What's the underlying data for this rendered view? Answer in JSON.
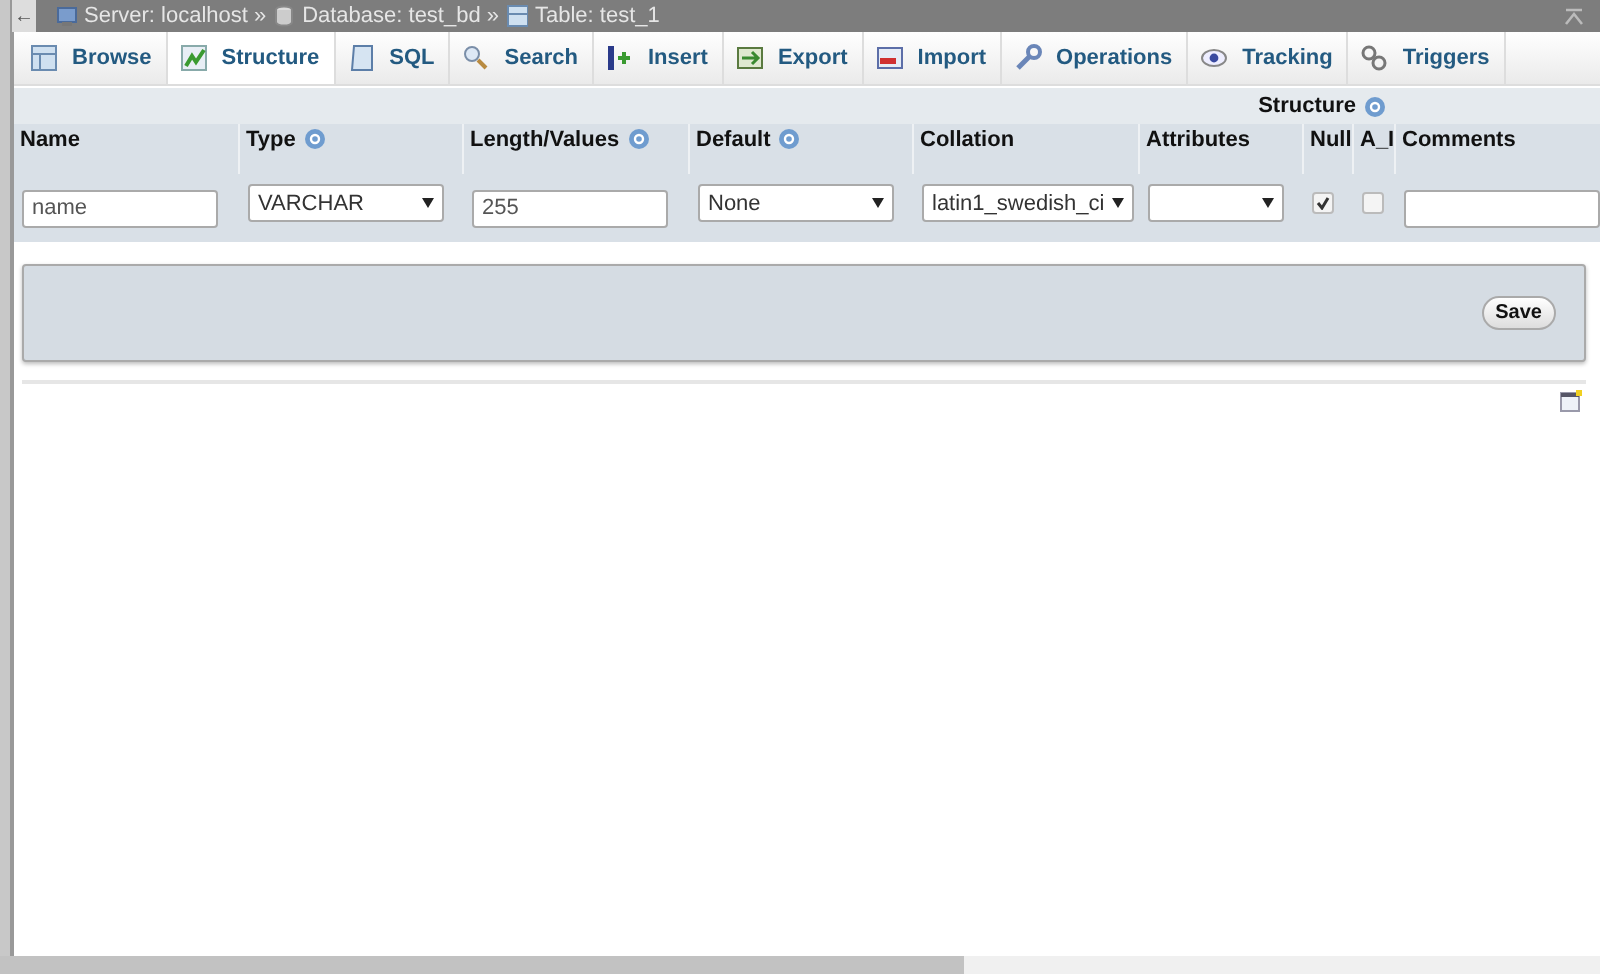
{
  "breadcrumb": {
    "back": "←",
    "items": [
      {
        "kind": "server",
        "label": "Server: localhost",
        "separator": "»"
      },
      {
        "kind": "database",
        "label": "Database: test_bd",
        "separator": "»"
      },
      {
        "kind": "table",
        "label": "Table: test_1"
      }
    ]
  },
  "tabs": [
    {
      "kind": "browse",
      "label": "Browse",
      "selected": false
    },
    {
      "kind": "structure",
      "label": "Structure",
      "selected": true
    },
    {
      "kind": "sql",
      "label": "SQL",
      "selected": false
    },
    {
      "kind": "search",
      "label": "Search",
      "selected": false
    },
    {
      "kind": "insert",
      "label": "Insert",
      "selected": false
    },
    {
      "kind": "export",
      "label": "Export",
      "selected": false
    },
    {
      "kind": "import",
      "label": "Import",
      "selected": false
    },
    {
      "kind": "operations",
      "label": "Operations",
      "selected": false
    },
    {
      "kind": "tracking",
      "label": "Tracking",
      "selected": false
    },
    {
      "kind": "triggers",
      "label": "Triggers",
      "selected": false
    }
  ],
  "field_table": {
    "group_title": "Structure",
    "columns": [
      {
        "label": "Name"
      },
      {
        "label": "Type",
        "help": true
      },
      {
        "label": "Length/Values",
        "help": true
      },
      {
        "label": "Default",
        "help": true
      },
      {
        "label": "Collation"
      },
      {
        "label": "Attributes"
      },
      {
        "label": "Null"
      },
      {
        "label": "A_I"
      },
      {
        "label": "Comments"
      }
    ],
    "row": [
      {
        "kind": "input",
        "value": "name"
      },
      {
        "kind": "select",
        "value": "VARCHAR"
      },
      {
        "kind": "input",
        "value": "255"
      },
      {
        "kind": "select",
        "value": "None"
      },
      {
        "kind": "select",
        "value": "latin1_swedish_ci"
      },
      {
        "kind": "select"
      },
      {
        "kind": "checkbox",
        "checked": true
      },
      {
        "kind": "checkbox",
        "checked": false
      },
      {
        "kind": "input"
      }
    ]
  },
  "save_button": "Save"
}
